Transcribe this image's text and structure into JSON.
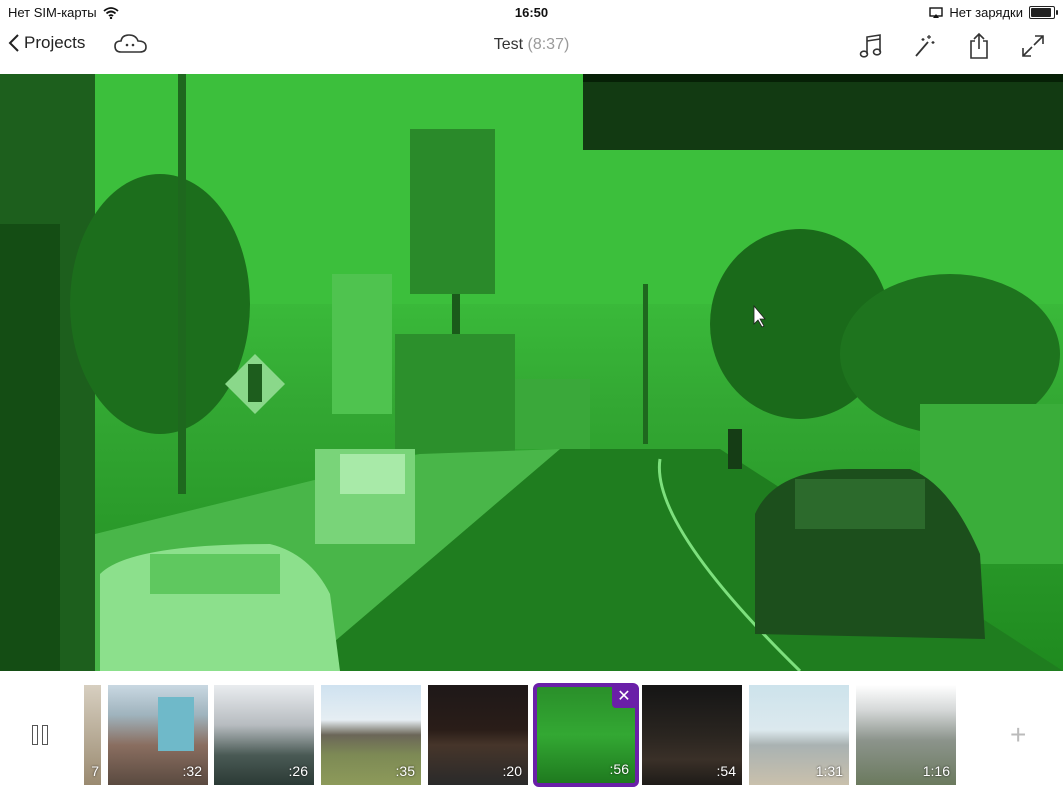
{
  "status_bar": {
    "carrier": "Нет SIM-карты",
    "time": "16:50",
    "charging": "Нет зарядки"
  },
  "nav": {
    "back_label": "Projects",
    "title": "Test",
    "duration": "(8:37)",
    "icons": [
      "cloud-icon",
      "music-icon",
      "magic-wand-icon",
      "share-icon",
      "fullscreen-icon"
    ]
  },
  "colors": {
    "accent": "#6a1fa8",
    "video_tint": "#33b033"
  },
  "timeline": {
    "clips": [
      {
        "duration": "7"
      },
      {
        "duration": ":32"
      },
      {
        "duration": ":26"
      },
      {
        "duration": ":35"
      },
      {
        "duration": ":20"
      },
      {
        "duration": ":56",
        "selected": true
      },
      {
        "duration": ":54"
      },
      {
        "duration": "1:31"
      },
      {
        "duration": "1:16"
      }
    ],
    "add_label": "+"
  }
}
